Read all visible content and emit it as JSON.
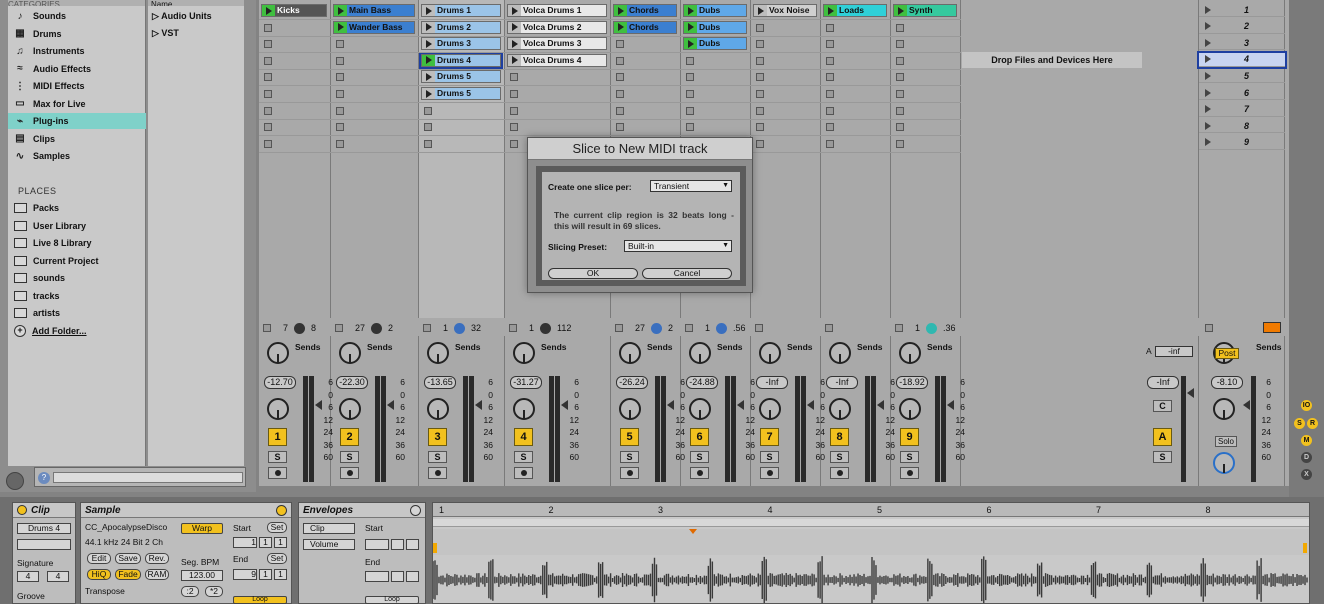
{
  "browser": {
    "categories_header": "CATEGORIES",
    "categories": [
      {
        "label": "Sounds",
        "icon": "speaker-icon"
      },
      {
        "label": "Drums",
        "icon": "grid-icon"
      },
      {
        "label": "Instruments",
        "icon": "keyboard-icon"
      },
      {
        "label": "Audio Effects",
        "icon": "audio-effects-icon"
      },
      {
        "label": "MIDI Effects",
        "icon": "midi-effects-icon"
      },
      {
        "label": "Max for Live",
        "icon": "max-icon"
      },
      {
        "label": "Plug-ins",
        "icon": "plug-icon",
        "selected": true
      },
      {
        "label": "Clips",
        "icon": "clip-icon"
      },
      {
        "label": "Samples",
        "icon": "wave-icon"
      }
    ],
    "places_header": "PLACES",
    "places": [
      "Packs",
      "User Library",
      "Live 8 Library",
      "Current Project",
      "sounds",
      "tracks",
      "artists",
      "Add Folder..."
    ],
    "content_header": "Name",
    "content_items": [
      "Audio Units",
      "VST"
    ]
  },
  "tracks": [
    {
      "num": "1",
      "volume": "-12.70",
      "pan_left": "7",
      "pan_right": "8",
      "clips": [
        {
          "name": "Kicks",
          "color": "#555555",
          "text": "#ffffff",
          "row": 0
        }
      ]
    },
    {
      "num": "2",
      "volume": "-22.30",
      "pan_left": "27",
      "pan_right": "2",
      "clips": [
        {
          "name": "Main Bass",
          "color": "#3b7fd0",
          "row": 0
        },
        {
          "name": "Wander Bass",
          "color": "#3b7fd0",
          "row": 1
        }
      ]
    },
    {
      "num": "3",
      "volume": "-13.65",
      "pan_left": "1",
      "pan_right": "32",
      "clips": [
        {
          "name": "Drums 1",
          "color": "#9bc4e8",
          "row": 0
        },
        {
          "name": "Drums 2",
          "color": "#9bc4e8",
          "row": 1
        },
        {
          "name": "Drums 3",
          "color": "#9bc4e8",
          "row": 2
        },
        {
          "name": "Drums 4",
          "color": "#9bc4e8",
          "row": 3,
          "selected": true
        },
        {
          "name": "Drums 5",
          "color": "#9bc4e8",
          "row": 4
        },
        {
          "name": "Drums 5",
          "color": "#9bc4e8",
          "row": 5
        }
      ]
    },
    {
      "num": "4",
      "volume": "-31.27",
      "pan_left": "1",
      "pan_right": "112",
      "clips": [
        {
          "name": "Volca Drums 1",
          "color": "#e8e8e8",
          "row": 0
        },
        {
          "name": "Volca Drums 2",
          "color": "#e8e8e8",
          "row": 1
        },
        {
          "name": "Volca Drums 3",
          "color": "#e8e8e8",
          "row": 2
        },
        {
          "name": "Volca Drums 4",
          "color": "#e8e8e8",
          "row": 3
        }
      ]
    },
    {
      "num": "5",
      "volume": "-26.24",
      "pan_left": "27",
      "pan_right": "2",
      "clips": [
        {
          "name": "Chords",
          "color": "#3b7fd0",
          "row": 0
        },
        {
          "name": "Chords",
          "color": "#3b7fd0",
          "row": 1
        }
      ]
    },
    {
      "num": "6",
      "volume": "-24.88",
      "pan_left": "1",
      "pan_right": ".56",
      "clips": [
        {
          "name": "Dubs",
          "color": "#5fa8e8",
          "row": 0
        },
        {
          "name": "Dubs",
          "color": "#5fa8e8",
          "row": 1
        },
        {
          "name": "Dubs",
          "color": "#5fa8e8",
          "row": 2
        }
      ]
    },
    {
      "num": "7",
      "volume": "-Inf",
      "pan_left": "",
      "pan_right": "",
      "clips": [
        {
          "name": "Vox Noise",
          "color": "#cfcfcf",
          "row": 0
        }
      ]
    },
    {
      "num": "8",
      "volume": "-Inf",
      "pan_left": "",
      "pan_right": "",
      "clips": [
        {
          "name": "Loads",
          "color": "#2fd0d8",
          "row": 0
        }
      ]
    },
    {
      "num": "9",
      "volume": "-18.92",
      "pan_left": "1",
      "pan_right": ".36",
      "clips": [
        {
          "name": "Synth",
          "color": "#35c99e",
          "row": 0
        }
      ]
    }
  ],
  "scale_labels": [
    "6",
    "0",
    "6",
    "12",
    "24",
    "36",
    "60"
  ],
  "sends_label": "Sends",
  "dropzone": "Drop Files and Devices Here",
  "return_a": {
    "volume": "-Inf",
    "io": "-inf",
    "letter": "A",
    "btn": "C",
    "s": "S",
    "a_label": "A"
  },
  "master": {
    "volume": "-8.10",
    "post": "Post",
    "solo": "Solo"
  },
  "scenes": [
    "1",
    "2",
    "3",
    "4",
    "5",
    "6",
    "7",
    "8",
    "9"
  ],
  "dialog": {
    "title": "Slice to New MIDI track",
    "slice_label": "Create one slice per:",
    "slice_value": "Transient",
    "info": "The current clip region is 32 beats long - this will result in 69 slices.",
    "preset_label": "Slicing Preset:",
    "preset_value": "Built-in",
    "ok": "OK",
    "cancel": "Cancel"
  },
  "right_strip": [
    "IO",
    "S",
    "R",
    "M",
    "D",
    "X"
  ],
  "detail": {
    "clip_title": "Clip",
    "clip_name": "Drums 4",
    "signature_label": "Signature",
    "sig_num": "4",
    "sig_den": "4",
    "groove_label": "Groove",
    "sample_title": "Sample",
    "sample_name": "CC_ApocalypseDisco",
    "sample_info": "44.1 kHz 24 Bit 2 Ch",
    "edit": "Edit",
    "save": "Save",
    "rev": "Rev.",
    "hiq": "HiQ",
    "fade": "Fade",
    "ram": "RAM",
    "transpose": "Transpose",
    "warp": "Warp",
    "seg_bpm_label": "Seg. BPM",
    "seg_bpm": "123.00",
    "half": ":2",
    "double": "*2",
    "start_label": "Start",
    "end_label": "End",
    "set": "Set",
    "start_vals": [
      "1",
      "1",
      "1"
    ],
    "end_vals": [
      "9",
      "1",
      "1"
    ],
    "loop": "Loop",
    "env_title": "Envelopes",
    "env_source": "Clip",
    "env_param": "Volume",
    "env_start": "Start",
    "env_end": "End",
    "env_loop": "Loop",
    "ruler": [
      "1",
      "2",
      "3",
      "4",
      "5",
      "6",
      "7",
      "8"
    ]
  }
}
